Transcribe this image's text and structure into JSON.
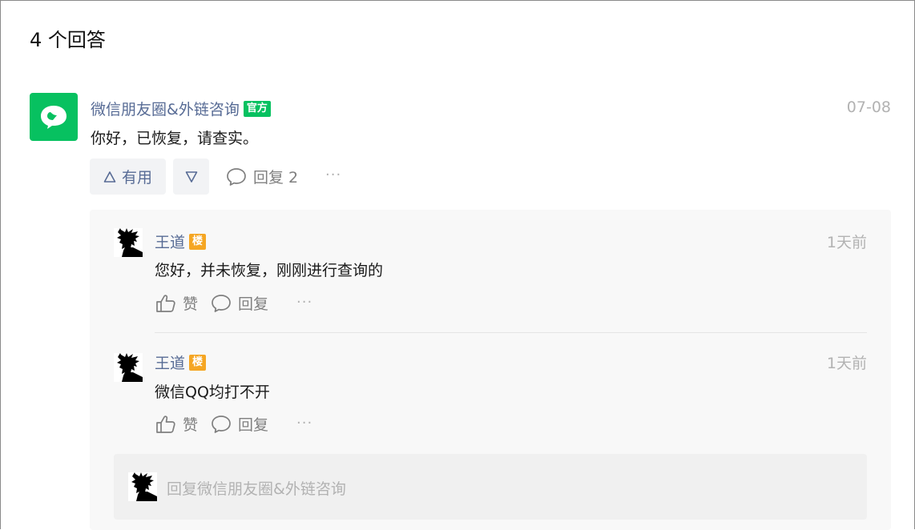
{
  "header": {
    "title": "4 个回答"
  },
  "answer": {
    "author": "微信朋友圈&外链咨询",
    "badge": "官方",
    "date": "07-08",
    "content": "你好，已恢复，请查实。",
    "useful_label": "有用",
    "reply_label": "回复 2",
    "more": "···"
  },
  "comments": [
    {
      "author": "王道",
      "badge": "楼",
      "date": "1天前",
      "content": "您好，并未恢复，刚刚进行查询的",
      "like_label": "赞",
      "reply_label": "回复",
      "more": "···"
    },
    {
      "author": "王道",
      "badge": "楼",
      "date": "1天前",
      "content": "微信QQ均打不开",
      "like_label": "赞",
      "reply_label": "回复",
      "more": "···"
    }
  ],
  "reply_box": {
    "placeholder": "回复微信朋友圈&外链咨询"
  },
  "colors": {
    "brand_green": "#07c160",
    "link_blue": "#576b95",
    "tag_orange": "#f5a623"
  }
}
